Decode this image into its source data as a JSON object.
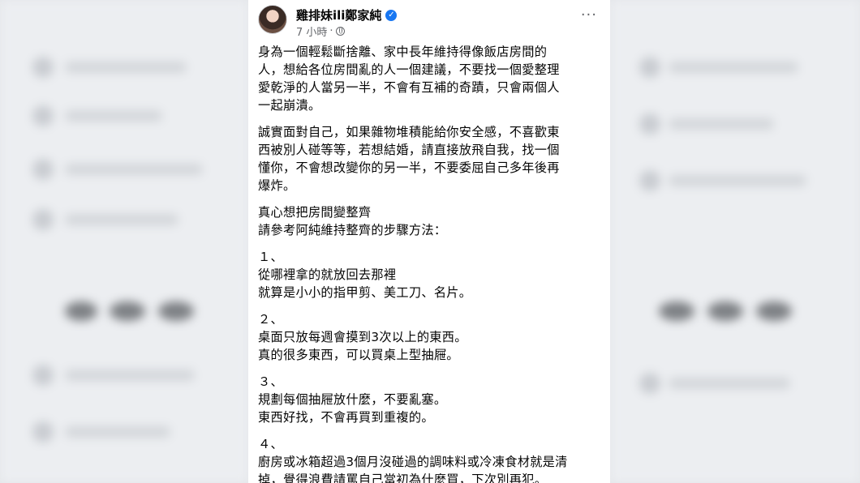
{
  "post": {
    "author": "雞排妹ili鄭家純",
    "time": "7 小時",
    "separator": "·",
    "paragraphs": [
      {
        "lines": [
          "身為一個輕鬆斷捨離、家中長年維持得像飯店房間的",
          "人，想給各位房間亂的人一個建議，不要找一個愛整理",
          "愛乾淨的人當另一半，不會有互補的奇蹟，只會兩個人",
          "一起崩潰。"
        ]
      },
      {
        "lines": [
          "誠實面對自己，如果雜物堆積能給你安全感，不喜歡東",
          "西被別人碰等等，若想結婚，請直接放飛自我，找一個",
          "懂你，不會想改變你的另一半，不要委屈自己多年後再",
          "爆炸。"
        ]
      },
      {
        "lines": [
          "真心想把房間變整齊",
          "請參考阿純維持整齊的步驟方法："
        ]
      },
      {
        "lines": [
          "１、",
          "從哪裡拿的就放回去那裡",
          "就算是小小的指甲剪、美工刀、名片。"
        ]
      },
      {
        "lines": [
          "２、",
          "桌面只放每週會摸到3次以上的東西。",
          "真的很多東西，可以買桌上型抽屜。"
        ]
      },
      {
        "lines": [
          "３、",
          "規劃每個抽屜放什麼，不要亂塞。",
          "東西好找，不會再買到重複的。"
        ]
      },
      {
        "lines": [
          "４、",
          "廚房或冰箱超過3個月沒碰過的調味料或冷凍食材就是清",
          "掉，覺得浪費請罵自己當初為什麼買，下次別再犯。"
        ]
      }
    ]
  },
  "icons": {
    "verified": "verified-badge-icon",
    "globe": "globe-icon",
    "more": "more-options-icon"
  },
  "colors": {
    "verified": "#1877f2",
    "text": "#050505",
    "meta": "#65676b",
    "background": "#e4e6ea"
  }
}
